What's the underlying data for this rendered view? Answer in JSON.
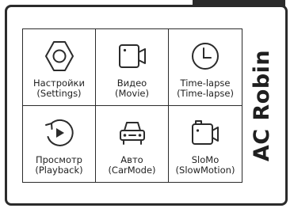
{
  "brand": {
    "name": "AC Robin"
  },
  "colors": {
    "ink": "#2b2b2b",
    "background": "#ffffff"
  },
  "menu": {
    "tiles": [
      {
        "icon": "settings-gear-icon",
        "label_ru": "Настройки",
        "label_en": "(Settings)"
      },
      {
        "icon": "video-camera-icon",
        "label_ru": "Видео",
        "label_en": "(Movie)"
      },
      {
        "icon": "clock-icon",
        "label_ru": "Time-lapse",
        "label_en": "(Time-lapse)"
      },
      {
        "icon": "playback-icon",
        "label_ru": "Просмотр",
        "label_en": "(Playback)"
      },
      {
        "icon": "car-icon",
        "label_ru": "Авто",
        "label_en": "(CarMode)"
      },
      {
        "icon": "slowmo-camera-icon",
        "label_ru": "SloMo",
        "label_en": "(SlowMotion)"
      }
    ]
  }
}
